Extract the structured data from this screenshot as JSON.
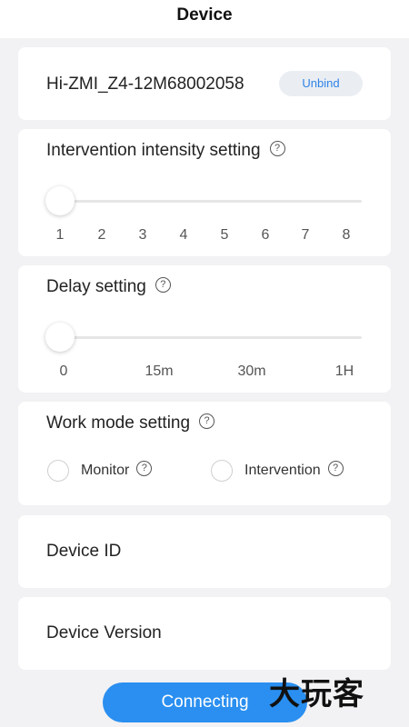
{
  "header": {
    "title": "Device"
  },
  "device": {
    "name": "Hi-ZMI_Z4-12M68002058",
    "unbind_label": "Unbind"
  },
  "intensity": {
    "title": "Intervention intensity setting",
    "help_icon": "question-circle-icon",
    "ticks": [
      "1",
      "2",
      "3",
      "4",
      "5",
      "6",
      "7",
      "8"
    ],
    "selected": "1"
  },
  "delay": {
    "title": "Delay setting",
    "help_icon": "question-circle-icon",
    "ticks": [
      "0",
      "15m",
      "30m",
      "1H"
    ],
    "selected": "0"
  },
  "work_mode": {
    "title": "Work mode setting",
    "options": [
      {
        "label": "Monitor",
        "selected": false
      },
      {
        "label": "Intervention",
        "selected": false
      }
    ]
  },
  "device_id": {
    "label": "Device ID"
  },
  "device_version": {
    "label": "Device Version"
  },
  "connect_button": {
    "label": "Connecting"
  },
  "watermark": {
    "text": "大玩客"
  },
  "colors": {
    "accent": "#2a8ff0",
    "unbind_text": "#2f82e6",
    "background": "#f2f2f4"
  }
}
